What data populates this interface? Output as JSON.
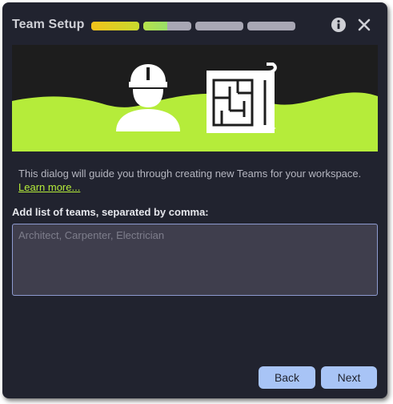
{
  "dialog": {
    "title": "Team Setup",
    "progress": [
      1.0,
      0.5,
      0,
      0
    ]
  },
  "banner": {
    "left_icon": "construction-worker-icon",
    "right_icon": "blueprint-icon",
    "accent_color": "#b5ec3a"
  },
  "body": {
    "description": "This dialog will guide you through creating new Teams for your workspace.",
    "learn_more": "Learn more...",
    "field_label": "Add list of teams, separated by comma:",
    "teams_value": "",
    "teams_placeholder": "Architect, Carpenter, Electrician"
  },
  "footer": {
    "back_label": "Back",
    "next_label": "Next"
  },
  "colors": {
    "dialog_bg": "#21232f",
    "button": "#a8c4f6",
    "link": "#b5ec3a"
  }
}
